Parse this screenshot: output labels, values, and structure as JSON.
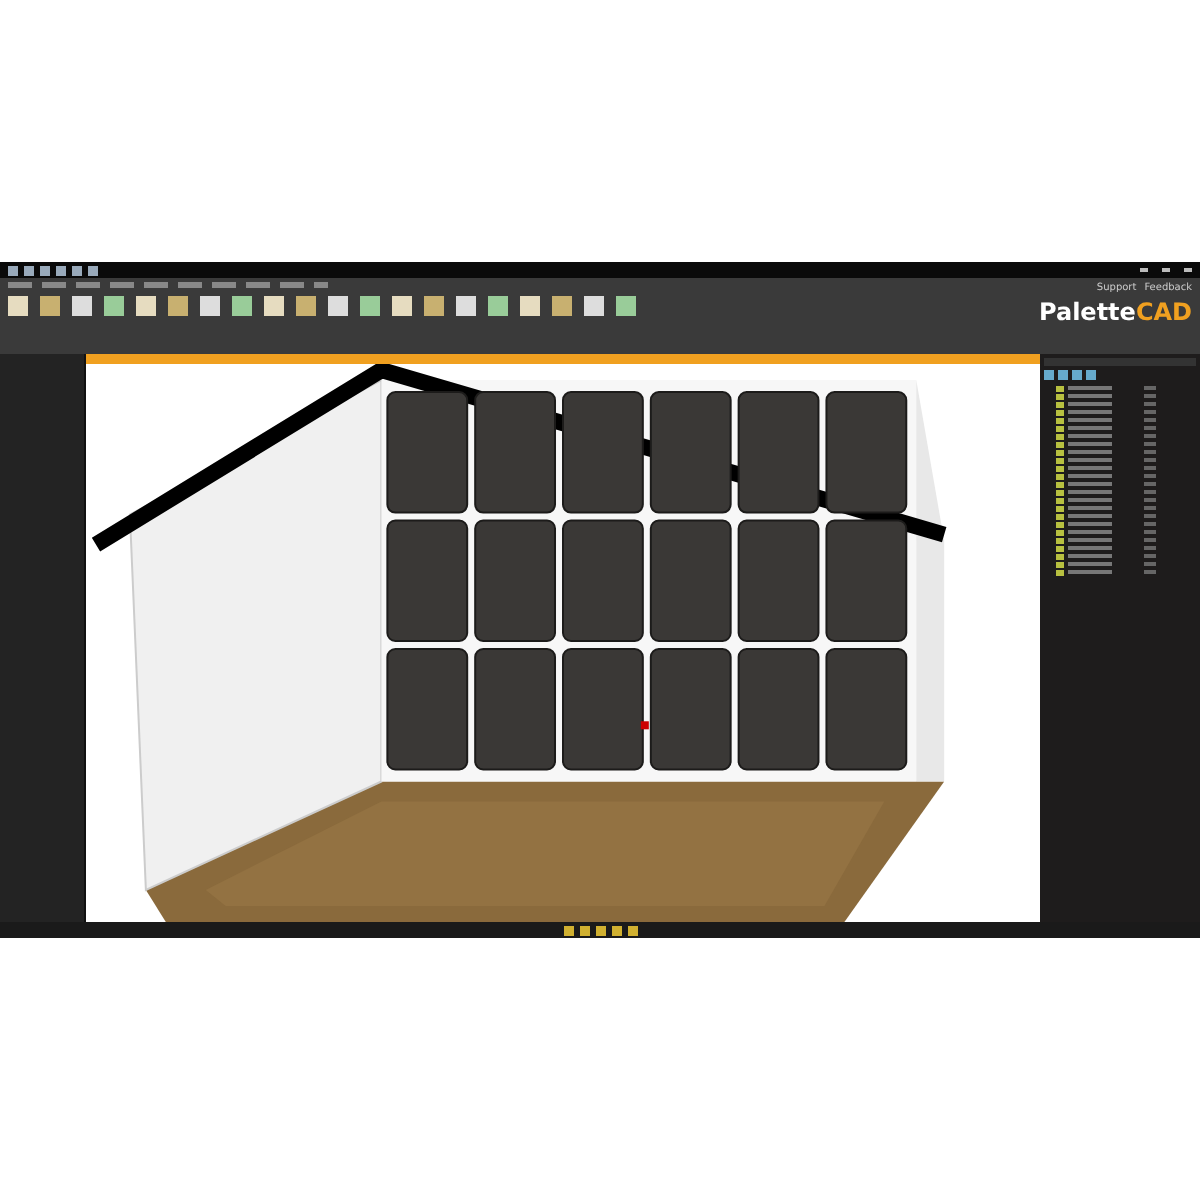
{
  "header_links": [
    "Support",
    "Feedback"
  ],
  "brand": {
    "text": "Palette",
    "accent": "CAD"
  }
}
